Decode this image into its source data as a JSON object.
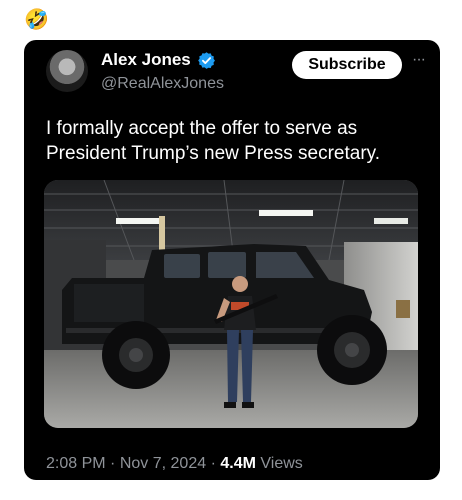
{
  "top": {
    "emoji": "🤣",
    "emoji_icon": "rolling-on-floor-laughing-icon"
  },
  "tweet": {
    "display_name": "Alex Jones",
    "handle": "@RealAlexJones",
    "verified_icon": "verified-badge-icon",
    "subscribe_label": "Subscribe",
    "more_label": "···",
    "text": "I formally accept the offer to serve as President Trump’s new Press secretary.",
    "time": "2:08 PM",
    "separator": "·",
    "date": "Nov 7, 2024",
    "views_count": "4.4M",
    "views_label": "Views",
    "colors": {
      "background": "#000000",
      "secondary_text": "#8f9399",
      "verified": "#1d9bf0"
    }
  }
}
